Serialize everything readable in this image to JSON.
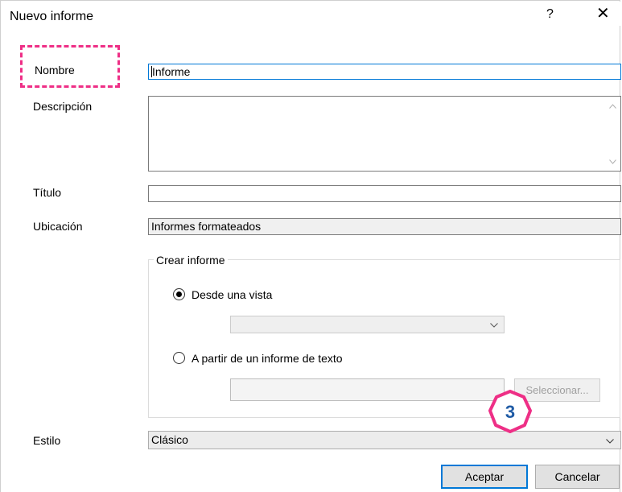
{
  "window": {
    "title": "Nuevo informe",
    "help_label": "?",
    "close_label": "✕"
  },
  "form": {
    "name_label": "Nombre",
    "name_value": "Informe",
    "description_label": "Descripción",
    "description_value": "",
    "title_label": "Título",
    "title_value": "",
    "location_label": "Ubicación",
    "location_value": "Informes formateados"
  },
  "create_group": {
    "legend": "Crear informe",
    "option_view": "Desde una vista",
    "option_view_selected": true,
    "view_combo_value": "",
    "option_text": "A partir de un informe de texto",
    "option_text_selected": false,
    "text_file_value": "",
    "select_button": "Seleccionar..."
  },
  "style": {
    "label": "Estilo",
    "value": "Clásico"
  },
  "buttons": {
    "ok": "Aceptar",
    "cancel": "Cancelar"
  },
  "annotation": {
    "step_number": "3",
    "accent_color": "#ee2f86"
  },
  "icons": {
    "chevron": "chevron-down-icon",
    "scroll_up": "chevron-up-icon",
    "scroll_down": "chevron-down-icon"
  }
}
